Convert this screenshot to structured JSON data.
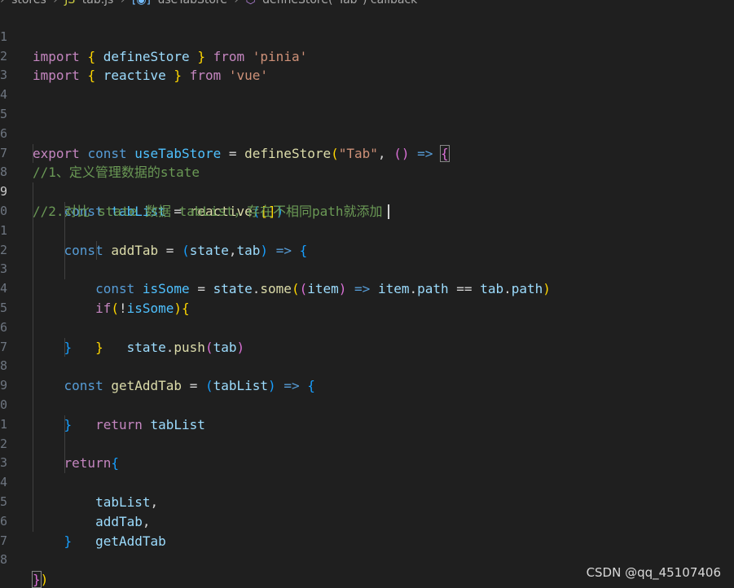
{
  "breadcrumb": {
    "items": [
      "stores",
      "tab.js",
      "useTabStore",
      "defineStore(\"Tab\") callback"
    ],
    "icons": [
      "chevron-right",
      "js-file-icon",
      "symbol-variable-icon",
      "symbol-method-icon"
    ]
  },
  "code": {
    "line_numbers": [
      "1",
      "2",
      "3",
      "4",
      "5",
      "6",
      "7",
      "8",
      "9",
      "0",
      "1",
      "2",
      "3",
      "4",
      "5",
      "6",
      "7",
      "8",
      "9",
      "0",
      "1",
      "2",
      "3",
      "4",
      "5",
      "6",
      "7",
      "8"
    ],
    "active_line": "9",
    "lines": [
      "import { defineStore } from 'pinia'",
      "import { reactive } from 'vue'",
      "",
      "",
      "",
      "export const useTabStore = defineStore(\"Tab\", () => {",
      "//1、定义管理数据的state",
      "    const tabList = reactive([])",
      "//2.对比 state 数据 tabList，存在不相同path就添加",
      "    const addTab = (state,tab) => {",
      "        const isSome = state.some((item) => item.path == tab.path)",
      "        if(!isSome){",
      "            state.push(tab)",
      "        }",
      "    }",
      "",
      "    const getAddTab = (tabList) => {",
      "        return tabList",
      "    }",
      "",
      "    return{",
      "        tabList,",
      "        addTab,",
      "        getAddTab",
      "    }",
      "",
      "",
      "})"
    ]
  },
  "watermark": "CSDN @qq_45107406",
  "colors": {
    "background": "#1f1f1f",
    "keyword": "#569cd6",
    "control": "#c586c0",
    "function": "#dcdcaa",
    "string": "#ce9178",
    "variable": "#9cdcfe",
    "comment": "#6a9955",
    "bracket1": "#ffd700",
    "bracket2": "#da70d6",
    "bracket3": "#179fff"
  }
}
